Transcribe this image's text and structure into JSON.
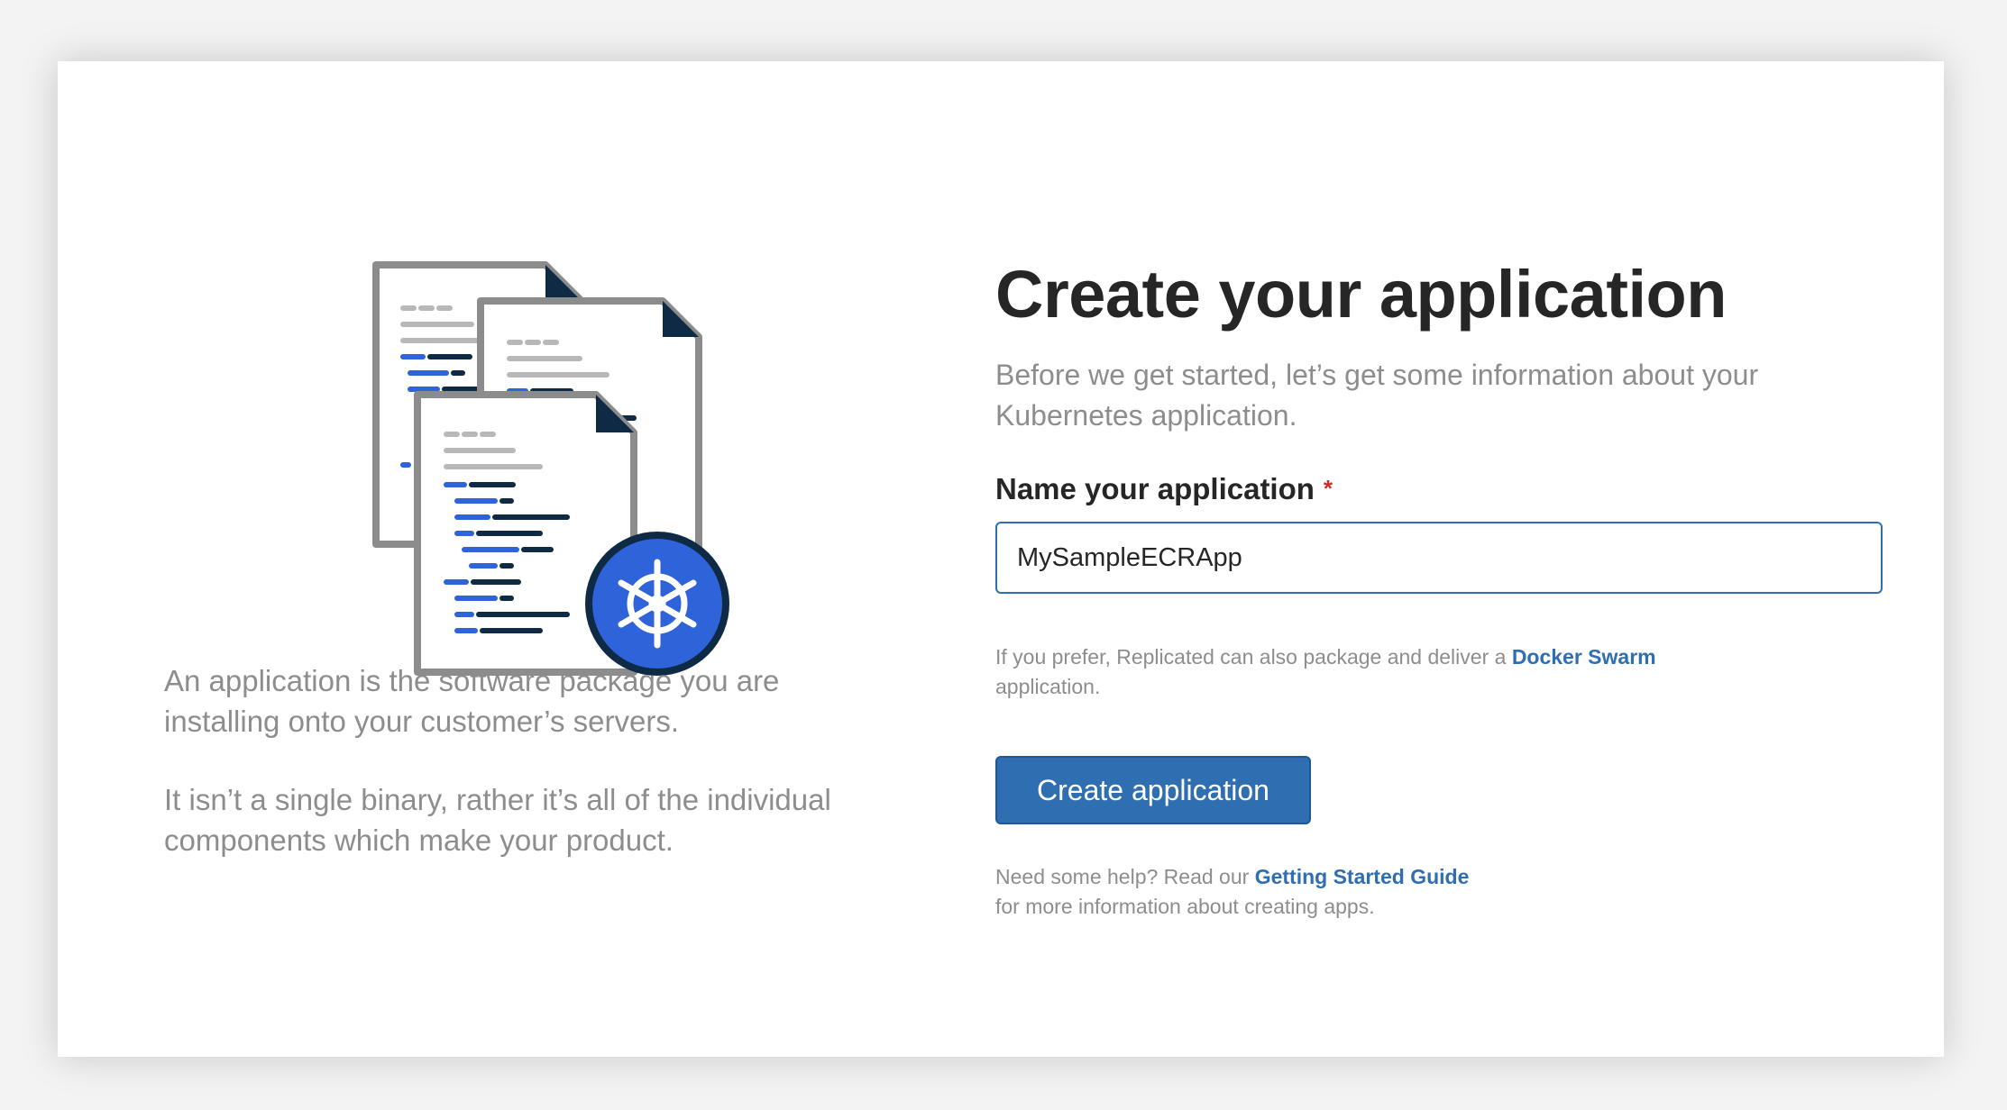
{
  "page": {
    "title": "Create your application",
    "subtitle": "Before we get started, let’s get some information about your Kubernetes application."
  },
  "illustration": {
    "icon": "kubernetes-documents-icon",
    "colors": {
      "accent": "#2f63d9",
      "dark": "#0e2a45",
      "gray": "#8c8c8c"
    }
  },
  "description": {
    "p1": "An application is the software package you are installing onto your customer’s servers.",
    "p2": "It isn’t a single binary, rather it’s all of the individual components which make your product."
  },
  "form": {
    "name_label": "Name your application",
    "required_mark": "*",
    "name_value": "MySampleECRApp",
    "note_before": "If you prefer, Replicated can also package and deliver a ",
    "note_link": "Docker Swarm",
    "note_after": "application.",
    "submit_label": "Create application"
  },
  "help": {
    "before": "Need some help? Read our ",
    "link": "Getting Started Guide",
    "after": "for more information about creating apps."
  },
  "colors": {
    "primary": "#2f6eb0",
    "required": "#cc2b2b",
    "heading": "#262626",
    "muted": "#8d8d8d"
  }
}
